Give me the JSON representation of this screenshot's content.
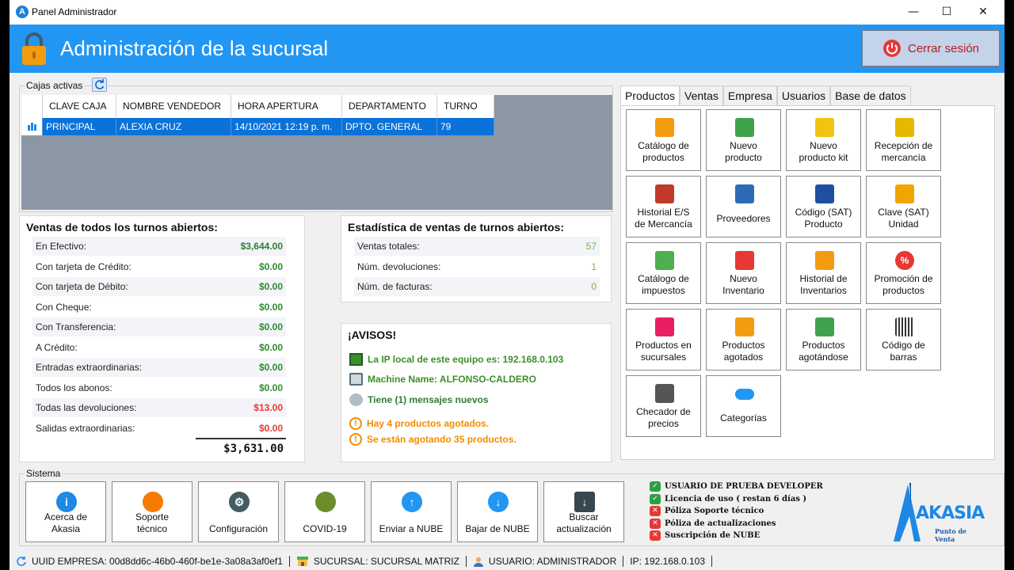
{
  "window": {
    "title": "Panel Administrador",
    "minimize": "—",
    "maximize": "☐",
    "close": "✕"
  },
  "header": {
    "title": "Administración de la sucursal",
    "logout_label": "Cerrar sesión"
  },
  "cajas": {
    "group_label": "Cajas activas",
    "columns": [
      "CLAVE CAJA",
      "NOMBRE VENDEDOR",
      "HORA APERTURA",
      "DEPARTAMENTO",
      "TURNO"
    ],
    "rows": [
      [
        "PRINCIPAL",
        "ALEXIA CRUZ",
        "14/10/2021 12:19 p. m.",
        "DPTO. GENERAL",
        "79"
      ]
    ]
  },
  "ventas": {
    "title": "Ventas de todos los turnos abiertos:",
    "rows": [
      {
        "label": "En Efectivo:",
        "value": "$3,644.00",
        "color": "#2e7d32"
      },
      {
        "label": "Con tarjeta de Crédito:",
        "value": "$0.00",
        "color": "#2e8b2e"
      },
      {
        "label": "Con tarjeta de Débito:",
        "value": "$0.00",
        "color": "#2e8b2e"
      },
      {
        "label": "Con Cheque:",
        "value": "$0.00",
        "color": "#2e8b2e"
      },
      {
        "label": "Con Transferencia:",
        "value": "$0.00",
        "color": "#2e8b2e"
      },
      {
        "label": "A Crédito:",
        "value": "$0.00",
        "color": "#2e8b2e"
      },
      {
        "label": "Entradas extraordinarias:",
        "value": "$0.00",
        "color": "#2e8b2e"
      },
      {
        "label": "Todos los abonos:",
        "value": "$0.00",
        "color": "#2e8b2e"
      },
      {
        "label": "Todas las devoluciones:",
        "value": "$13.00",
        "color": "#e53935"
      },
      {
        "label": "Salidas extraordinarias:",
        "value": "$0.00",
        "color": "#e53935"
      }
    ],
    "total": "$3,631.00"
  },
  "estadistica": {
    "title": "Estadística de ventas de turnos abiertos:",
    "rows": [
      {
        "label": "Ventas totales:",
        "value": "57"
      },
      {
        "label": "Núm. devoluciones:",
        "value": "1"
      },
      {
        "label": "Núm. de facturas:",
        "value": "0"
      }
    ]
  },
  "avisos": {
    "title": "¡AVISOS!",
    "items": [
      {
        "text": "La IP local de este equipo es: 192.168.0.103",
        "color": "#3e8e2b",
        "icon": "network-icon"
      },
      {
        "text": "Machine Name: ALFONSO-CALDERO",
        "color": "#3e8e2b",
        "icon": "computer-icon"
      },
      {
        "text": "Tiene (1) mensajes nuevos",
        "color": "#2e7d32",
        "icon": "message-icon"
      },
      {
        "text": "Hay 4 productos agotados.",
        "color": "#f28c00",
        "icon": "warning-icon"
      },
      {
        "text": "Se están agotando 35 productos.",
        "color": "#f28c00",
        "icon": "warning-icon"
      }
    ]
  },
  "tabs": [
    "Productos",
    "Ventas",
    "Empresa",
    "Usuarios",
    "Base de datos"
  ],
  "product_buttons": [
    {
      "l1": "Catálogo de",
      "l2": "productos",
      "icon": "box-icon",
      "color": "#f39c12"
    },
    {
      "l1": "Nuevo",
      "l2": "producto",
      "icon": "green-box-icon",
      "color": "#3fa34d"
    },
    {
      "l1": "Nuevo",
      "l2": "producto kit",
      "icon": "toolbox-icon",
      "color": "#f1c40f"
    },
    {
      "l1": "Recepción de",
      "l2": "mercancía",
      "icon": "cart-icon",
      "color": "#e6b800"
    },
    {
      "l1": "Historial E/S",
      "l2": "de Mercancía",
      "icon": "presentation-icon",
      "color": "#c0392b"
    },
    {
      "l1": "",
      "l2": "Proveedores",
      "icon": "supplier-icon",
      "color": "#2d6cb5"
    },
    {
      "l1": "Código (SAT)",
      "l2": "Producto",
      "icon": "qr-code-icon",
      "color": "#1f4fa0"
    },
    {
      "l1": "Clave (SAT)",
      "l2": "Unidad",
      "icon": "tag-icon",
      "color": "#f0a500"
    },
    {
      "l1": "Catálogo de",
      "l2": "impuestos",
      "icon": "money-icon",
      "color": "#4caf50"
    },
    {
      "l1": "Nuevo",
      "l2": "Inventario",
      "icon": "inventory-icon",
      "color": "#e53935"
    },
    {
      "l1": "Historial de",
      "l2": "Inventarios",
      "icon": "boxes-icon",
      "color": "#f39c12"
    },
    {
      "l1": "Promoción de",
      "l2": "productos",
      "icon": "percent-icon",
      "color": "#e53935"
    },
    {
      "l1": "Productos en",
      "l2": "sucursales",
      "icon": "transfer-icon",
      "color": "#e91e63"
    },
    {
      "l1": "Productos",
      "l2": "agotados",
      "icon": "out-of-stock-icon",
      "color": "#f39c12"
    },
    {
      "l1": "Productos",
      "l2": "agotándose",
      "icon": "low-stock-icon",
      "color": "#3fa34d"
    },
    {
      "l1": "Código de",
      "l2": "barras",
      "icon": "barcode-icon",
      "color": "#333333"
    },
    {
      "l1": "Checador de",
      "l2": "precios",
      "icon": "scanner-icon",
      "color": "#555555"
    },
    {
      "l1": "",
      "l2": "Categorías",
      "icon": "categories-icon",
      "color": "#2196f3"
    }
  ],
  "sistema": {
    "group_label": "Sistema",
    "buttons": [
      {
        "l1": "Acerca de",
        "l2": "Akasia",
        "icon": "info-icon",
        "color": "#1e88e5"
      },
      {
        "l1": "Soporte",
        "l2": "técnico",
        "icon": "support-icon",
        "color": "#f57c00"
      },
      {
        "l1": "",
        "l2": "Configuración",
        "icon": "gear-icon",
        "color": "#455a64"
      },
      {
        "l1": "",
        "l2": "COVID-19",
        "icon": "virus-icon",
        "color": "#6a8f2a"
      },
      {
        "l1": "",
        "l2": "Enviar a NUBE",
        "icon": "cloud-upload-icon",
        "color": "#2196f3"
      },
      {
        "l1": "",
        "l2": "Bajar de NUBE",
        "icon": "cloud-download-icon",
        "color": "#2196f3"
      },
      {
        "l1": "Buscar",
        "l2": "actualización",
        "icon": "update-icon",
        "color": "#37474f"
      }
    ],
    "license": [
      {
        "text": "USUARIO DE PRUEBA DEVELOPER",
        "ok": true
      },
      {
        "text": "Licencia de uso ( restan 6 días )",
        "ok": true
      },
      {
        "text": "Póliza Soporte técnico",
        "ok": false
      },
      {
        "text": "Póliza de actualizaciones",
        "ok": false
      },
      {
        "text": "Suscripción de NUBE",
        "ok": false
      }
    ],
    "logo_text": "AKASIA",
    "logo_sub": "Punto de Venta"
  },
  "status": {
    "uuid": "UUID EMPRESA: 00d8dd6c-46b0-460f-be1e-3a08a3af0ef1",
    "sucursal": "SUCURSAL: SUCURSAL MATRIZ",
    "usuario": "USUARIO: ADMINISTRADOR",
    "ip": "IP: 192.168.0.103"
  }
}
